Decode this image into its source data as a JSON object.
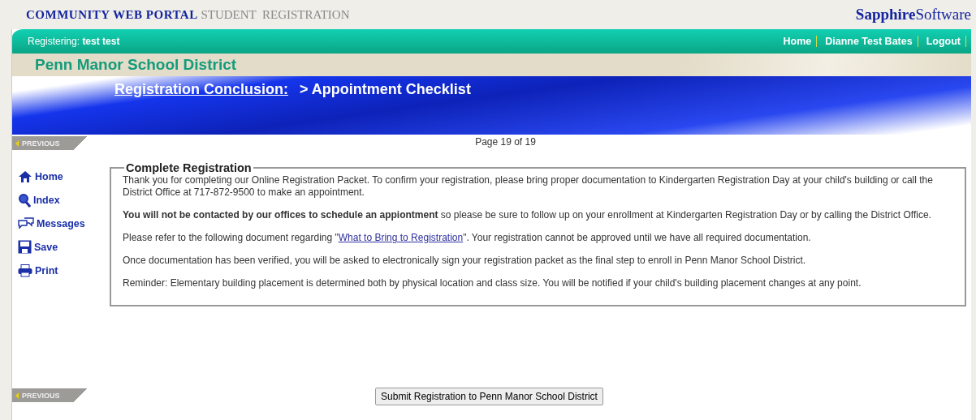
{
  "header": {
    "portal": "COMMUNITY WEB PORTAL",
    "section": "STUDENT  REGISTRATION",
    "brand_bold": "Sapphire",
    "brand_light": "Software"
  },
  "user_bar": {
    "label": "Registering:",
    "student": "test test",
    "links": [
      {
        "label": "Home"
      },
      {
        "label": "Dianne Test Bates"
      },
      {
        "label": "Logout"
      }
    ]
  },
  "district": "Penn Manor School District",
  "banner": {
    "section_link": "Registration Conclusion:",
    "page_title": "> Appointment Checklist"
  },
  "previous_top": "PREVIOUS",
  "page_indicator": "Page 19 of 19",
  "sidebar": {
    "items": [
      {
        "label": "Home",
        "kind": "home"
      },
      {
        "label": "Index",
        "kind": "search"
      },
      {
        "label": "Messages",
        "kind": "messages"
      },
      {
        "label": "Save",
        "kind": "save"
      },
      {
        "label": "Print",
        "kind": "print"
      }
    ]
  },
  "panel": {
    "title": "Complete Registration",
    "paragraphs": [
      {
        "text": "Thank you for completing our Online Registration Packet. To confirm your registration, please bring proper documentation to Kindergarten Registration Day at your child's building or call the District Office at 717-872-9500 to make an appointment."
      },
      {
        "text": "**You will not be contacted by our offices to schedule an appiontment** so please be sure to follow up on your enrollment at Kindergarten Registration Day or by calling the District Office."
      },
      {
        "text": "Please refer to the following document regarding \"",
        "link": "What to Bring to Registration",
        "after": "\". Your registration cannot be approved until we have all required documentation."
      },
      {
        "text": "Once documentation has been verified, you will be asked to electronically sign your registration packet as the final step to enroll in Penn Manor School District."
      },
      {
        "text": "Reminder: Elementary building placement is determined both by physical location and class size. You will be notified if your child's building placement changes at any point."
      }
    ]
  },
  "previous_bottom": "PREVIOUS",
  "submit_button": "Submit Registration to Penn Manor School District"
}
